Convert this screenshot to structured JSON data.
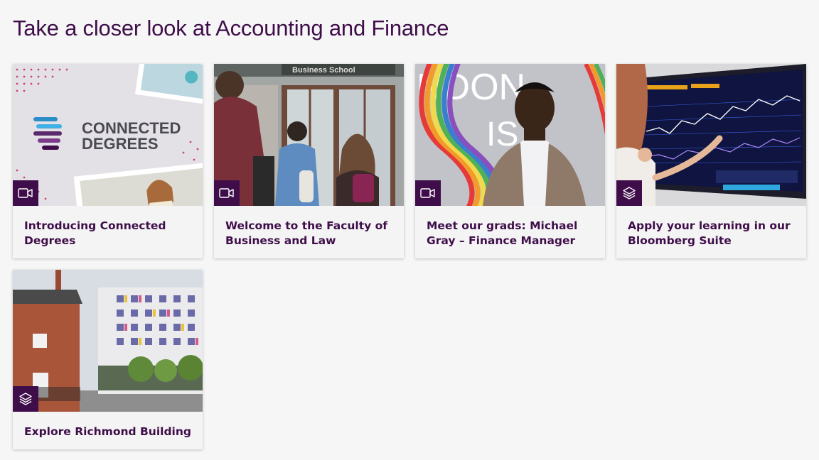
{
  "section": {
    "title": "Take a closer look at Accounting and Finance"
  },
  "cards": [
    {
      "title": "Introducing Connected Degrees",
      "type_icon": "video-camera-icon",
      "image_text": {
        "line1": "CONNECTED",
        "line2": "DEGREES"
      }
    },
    {
      "title": "Welcome to the Faculty of Business and Law",
      "type_icon": "video-camera-icon",
      "image_text": {
        "sign": "Business School"
      }
    },
    {
      "title": "Meet our grads: Michael Gray – Finance Manager",
      "type_icon": "video-camera-icon",
      "image_text": {
        "wall": "NDON",
        "wall2": "IS"
      }
    },
    {
      "title": "Apply your learning in our Bloomberg Suite",
      "type_icon": "layers-icon"
    },
    {
      "title": "Explore Richmond Building",
      "type_icon": "layers-icon"
    }
  ],
  "colors": {
    "brand": "#3f0e4a",
    "background": "#f6f6f6",
    "card": "#f4f4f4"
  }
}
